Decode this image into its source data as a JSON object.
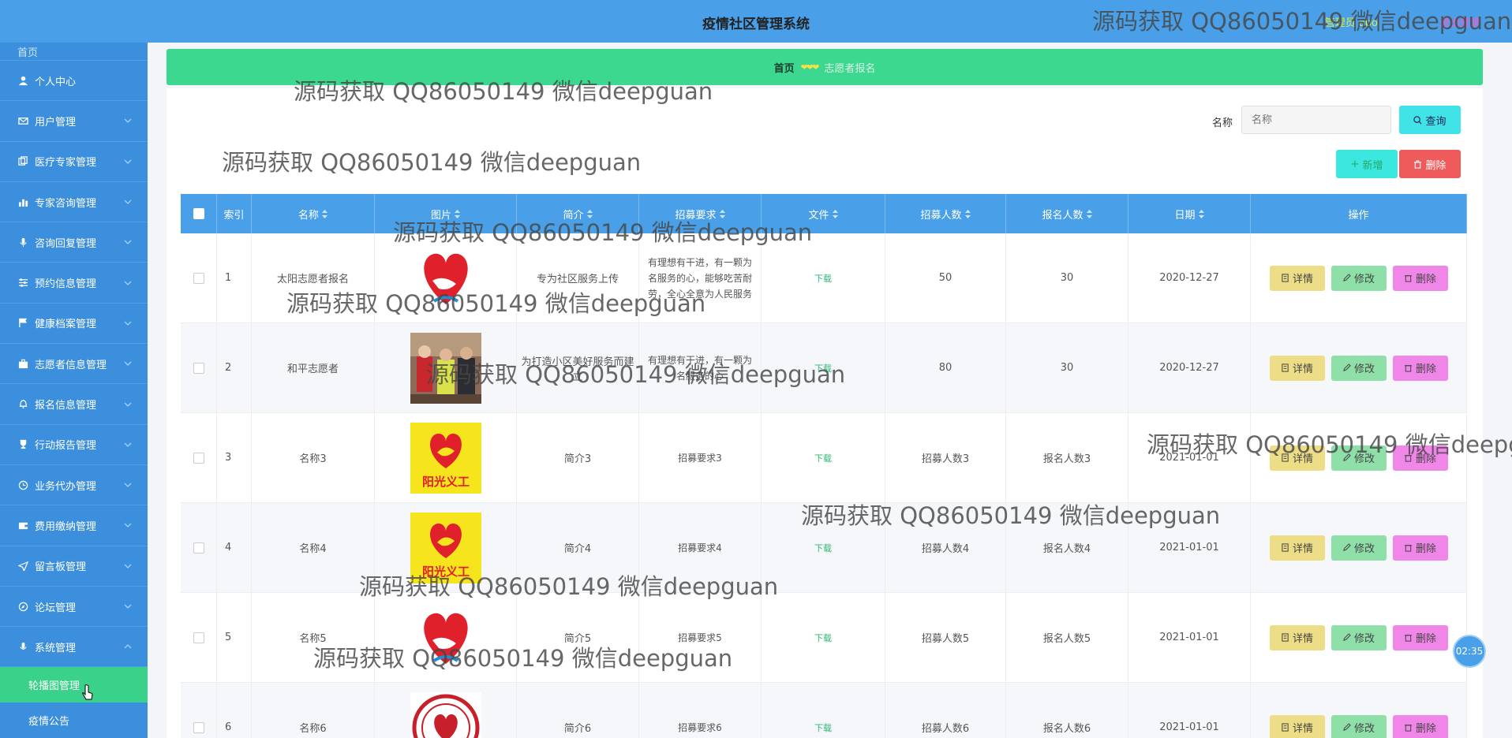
{
  "header": {
    "title": "疫情社区管理系统",
    "user_label": "管理员 abo",
    "logout_label": "退出登录"
  },
  "sidebar": {
    "items": [
      {
        "label": "首页",
        "icon": "home-icon"
      },
      {
        "label": "个人中心",
        "icon": "user-icon"
      },
      {
        "label": "用户管理",
        "icon": "mail-icon"
      },
      {
        "label": "医疗专家管理",
        "icon": "copy-icon"
      },
      {
        "label": "专家咨询管理",
        "icon": "bar-chart-icon"
      },
      {
        "label": "咨询回复管理",
        "icon": "mic-icon"
      },
      {
        "label": "预约信息管理",
        "icon": "sliders-icon"
      },
      {
        "label": "健康档案管理",
        "icon": "flag-icon"
      },
      {
        "label": "志愿者信息管理",
        "icon": "briefcase-icon"
      },
      {
        "label": "报名信息管理",
        "icon": "bell-icon"
      },
      {
        "label": "行动报告管理",
        "icon": "trophy-icon"
      },
      {
        "label": "业务代办管理",
        "icon": "clock-icon"
      },
      {
        "label": "费用缴纳管理",
        "icon": "wallet-icon"
      },
      {
        "label": "留言板管理",
        "icon": "send-icon"
      },
      {
        "label": "论坛管理",
        "icon": "compass-icon"
      },
      {
        "label": "系统管理",
        "icon": "microphone-icon"
      }
    ],
    "sub_items": [
      {
        "label": "轮播图管理",
        "active": true
      },
      {
        "label": "疫情公告",
        "active": false
      }
    ]
  },
  "breadcrumb": {
    "home": "首页",
    "separator": "❤❤❤",
    "current": "志愿者报名"
  },
  "search": {
    "label": "名称",
    "placeholder": "名称",
    "button": "查询"
  },
  "actions": {
    "add": "新增",
    "delete": "删除"
  },
  "table": {
    "columns": [
      "索引",
      "名称",
      "图片",
      "简介",
      "招募要求",
      "文件",
      "招募人数",
      "报名人数",
      "日期",
      "操作"
    ],
    "rows": [
      {
        "index": "1",
        "name": "太阳志愿者报名",
        "intro": "专为社区服务上传",
        "req": "有理想有干进，有一颗为名服务的心，能够吃苦耐劳，全心全意为人民服务",
        "file": "下载",
        "recruit": "50",
        "signed": "30",
        "date": "2020-12-27",
        "img": "heart-hand-logo"
      },
      {
        "index": "2",
        "name": "和平志愿者",
        "intro": "为打造小区美好服务而建立",
        "req": "有理想有干进，有一颗为名服务的心",
        "file": "下载",
        "recruit": "80",
        "signed": "30",
        "date": "2020-12-27",
        "img": "volunteer-photo"
      },
      {
        "index": "3",
        "name": "名称3",
        "intro": "简介3",
        "req": "招募要求3",
        "file": "下载",
        "recruit": "招募人数3",
        "signed": "报名人数3",
        "date": "2021-01-01",
        "img": "sunshine-volunteer-logo"
      },
      {
        "index": "4",
        "name": "名称4",
        "intro": "简介4",
        "req": "招募要求4",
        "file": "下载",
        "recruit": "招募人数4",
        "signed": "报名人数4",
        "date": "2021-01-01",
        "img": "sunshine-volunteer-logo"
      },
      {
        "index": "5",
        "name": "名称5",
        "intro": "简介5",
        "req": "招募要求5",
        "file": "下载",
        "recruit": "招募人数5",
        "signed": "报名人数5",
        "date": "2021-01-01",
        "img": "heart-hand-logo"
      },
      {
        "index": "6",
        "name": "名称6",
        "intro": "简介6",
        "req": "招募要求6",
        "file": "下载",
        "recruit": "招募人数6",
        "signed": "报名人数6",
        "date": "2021-01-01",
        "img": "round-seal-logo"
      }
    ],
    "op_labels": {
      "detail": "详情",
      "edit": "修改",
      "delete": "删除"
    }
  },
  "clock": "02:35",
  "watermark": "源码获取 QQ86050149 微信deepguan",
  "colors": {
    "header": "#4aa0e8",
    "sidebar": "#3c8fdc",
    "breadcrumb": "#3dd88f",
    "active_sub": "#3ad28a",
    "detail_btn": "#ecdd86",
    "edit_btn": "#8fe0a8",
    "delete_btn": "#f087e8"
  }
}
